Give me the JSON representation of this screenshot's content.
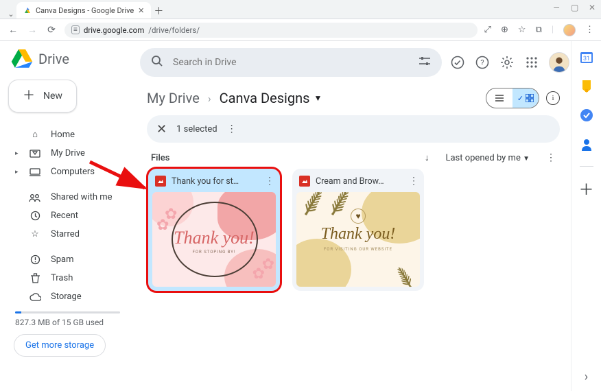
{
  "chrome": {
    "tab_title": "Canva Designs - Google Drive",
    "url_host": "drive.google.com",
    "url_path": "/drive/folders/"
  },
  "brand": "Drive",
  "new_button": "New",
  "sidebar": {
    "home": "Home",
    "mydrive": "My Drive",
    "computers": "Computers",
    "shared": "Shared with me",
    "recent": "Recent",
    "starred": "Starred",
    "spam": "Spam",
    "trash": "Trash",
    "storage": "Storage",
    "storage_used": "827.3 MB of 15 GB used",
    "get_more": "Get more storage"
  },
  "search": {
    "placeholder": "Search in Drive"
  },
  "breadcrumb": {
    "root": "My Drive",
    "current": "Canva Designs"
  },
  "selection": {
    "count_label": "1 selected"
  },
  "section_label": "Files",
  "sort": {
    "label": "Last opened by me"
  },
  "files": [
    {
      "name": "Thank you for st…",
      "thumb_text1": "Thank you!",
      "thumb_text2": "FOR STOPING BY!"
    },
    {
      "name": "Cream and Brow…",
      "thumb_text1": "Thank you!",
      "thumb_text2": "FOR VISITING OUR WEBSITE"
    }
  ]
}
